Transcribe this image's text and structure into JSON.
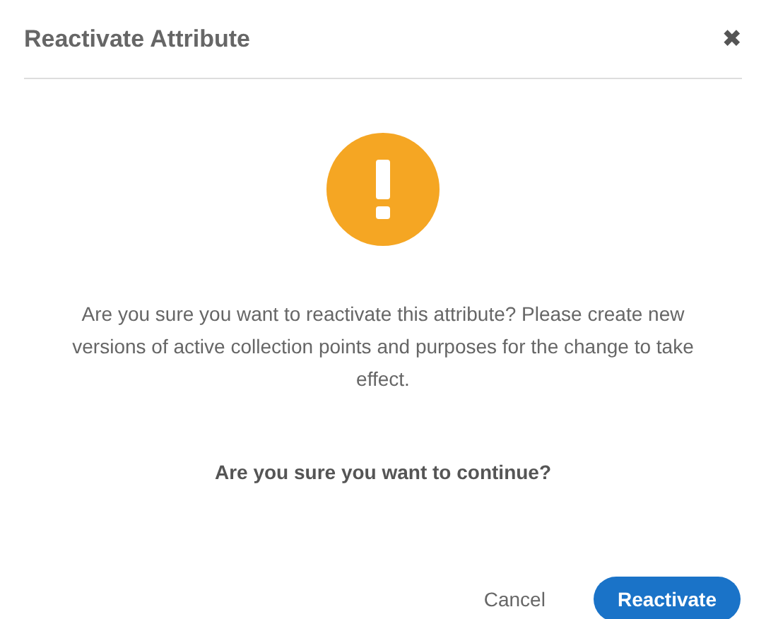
{
  "dialog": {
    "title": "Reactivate Attribute",
    "close": "✖",
    "message": "Are you sure you want to reactivate this attribute? Please create new versions of active collection points and purposes for the change to take effect.",
    "question": "Are you sure you want to continue?",
    "buttons": [
      {
        "label": "Cancel",
        "kind": "secondary"
      },
      {
        "label": "Reactivate",
        "kind": "primary"
      }
    ]
  }
}
